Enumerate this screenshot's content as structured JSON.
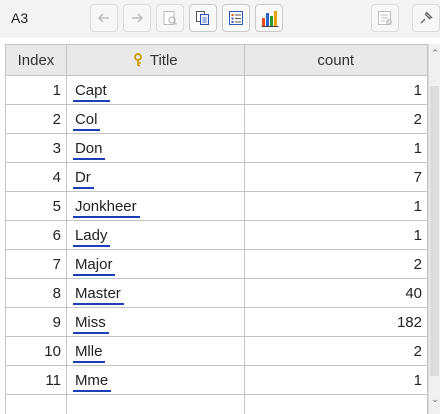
{
  "toolbar": {
    "cell_ref": "A3",
    "buttons": [
      "back-icon",
      "forward-icon",
      "preview-icon",
      "copy-icon",
      "form-icon",
      "chart-icon",
      "properties-icon",
      "pin-icon"
    ]
  },
  "table": {
    "headers": {
      "index": "Index",
      "title": "Title",
      "count": "count"
    },
    "rows": [
      {
        "index": "1",
        "title": "Capt",
        "count": "1"
      },
      {
        "index": "2",
        "title": "Col",
        "count": "2"
      },
      {
        "index": "3",
        "title": "Don",
        "count": "1"
      },
      {
        "index": "4",
        "title": "Dr",
        "count": "7"
      },
      {
        "index": "5",
        "title": "Jonkheer",
        "count": "1"
      },
      {
        "index": "6",
        "title": "Lady",
        "count": "1"
      },
      {
        "index": "7",
        "title": "Major",
        "count": "2"
      },
      {
        "index": "8",
        "title": "Master",
        "count": "40"
      },
      {
        "index": "9",
        "title": "Miss",
        "count": "182"
      },
      {
        "index": "10",
        "title": "Mlle",
        "count": "2"
      },
      {
        "index": "11",
        "title": "Mme",
        "count": "1"
      },
      {
        "index": "",
        "title": "",
        "count": ""
      }
    ]
  },
  "colors": {
    "link_underline": "#1b3fb8",
    "header_bg": "#e9e9e9",
    "key_icon": "#c99a00"
  }
}
